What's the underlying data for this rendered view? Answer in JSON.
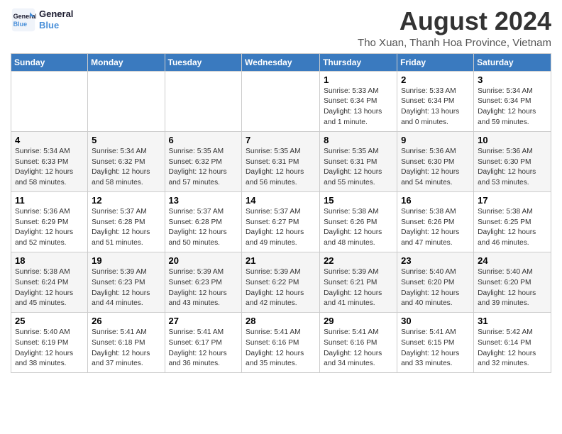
{
  "header": {
    "logo_line1": "General",
    "logo_line2": "Blue",
    "title": "August 2024",
    "subtitle": "Tho Xuan, Thanh Hoa Province, Vietnam"
  },
  "calendar": {
    "days_of_week": [
      "Sunday",
      "Monday",
      "Tuesday",
      "Wednesday",
      "Thursday",
      "Friday",
      "Saturday"
    ],
    "weeks": [
      [
        {
          "day": "",
          "info": ""
        },
        {
          "day": "",
          "info": ""
        },
        {
          "day": "",
          "info": ""
        },
        {
          "day": "",
          "info": ""
        },
        {
          "day": "1",
          "info": "Sunrise: 5:33 AM\nSunset: 6:34 PM\nDaylight: 13 hours\nand 1 minute."
        },
        {
          "day": "2",
          "info": "Sunrise: 5:33 AM\nSunset: 6:34 PM\nDaylight: 13 hours\nand 0 minutes."
        },
        {
          "day": "3",
          "info": "Sunrise: 5:34 AM\nSunset: 6:34 PM\nDaylight: 12 hours\nand 59 minutes."
        }
      ],
      [
        {
          "day": "4",
          "info": "Sunrise: 5:34 AM\nSunset: 6:33 PM\nDaylight: 12 hours\nand 58 minutes."
        },
        {
          "day": "5",
          "info": "Sunrise: 5:34 AM\nSunset: 6:32 PM\nDaylight: 12 hours\nand 58 minutes."
        },
        {
          "day": "6",
          "info": "Sunrise: 5:35 AM\nSunset: 6:32 PM\nDaylight: 12 hours\nand 57 minutes."
        },
        {
          "day": "7",
          "info": "Sunrise: 5:35 AM\nSunset: 6:31 PM\nDaylight: 12 hours\nand 56 minutes."
        },
        {
          "day": "8",
          "info": "Sunrise: 5:35 AM\nSunset: 6:31 PM\nDaylight: 12 hours\nand 55 minutes."
        },
        {
          "day": "9",
          "info": "Sunrise: 5:36 AM\nSunset: 6:30 PM\nDaylight: 12 hours\nand 54 minutes."
        },
        {
          "day": "10",
          "info": "Sunrise: 5:36 AM\nSunset: 6:30 PM\nDaylight: 12 hours\nand 53 minutes."
        }
      ],
      [
        {
          "day": "11",
          "info": "Sunrise: 5:36 AM\nSunset: 6:29 PM\nDaylight: 12 hours\nand 52 minutes."
        },
        {
          "day": "12",
          "info": "Sunrise: 5:37 AM\nSunset: 6:28 PM\nDaylight: 12 hours\nand 51 minutes."
        },
        {
          "day": "13",
          "info": "Sunrise: 5:37 AM\nSunset: 6:28 PM\nDaylight: 12 hours\nand 50 minutes."
        },
        {
          "day": "14",
          "info": "Sunrise: 5:37 AM\nSunset: 6:27 PM\nDaylight: 12 hours\nand 49 minutes."
        },
        {
          "day": "15",
          "info": "Sunrise: 5:38 AM\nSunset: 6:26 PM\nDaylight: 12 hours\nand 48 minutes."
        },
        {
          "day": "16",
          "info": "Sunrise: 5:38 AM\nSunset: 6:26 PM\nDaylight: 12 hours\nand 47 minutes."
        },
        {
          "day": "17",
          "info": "Sunrise: 5:38 AM\nSunset: 6:25 PM\nDaylight: 12 hours\nand 46 minutes."
        }
      ],
      [
        {
          "day": "18",
          "info": "Sunrise: 5:38 AM\nSunset: 6:24 PM\nDaylight: 12 hours\nand 45 minutes."
        },
        {
          "day": "19",
          "info": "Sunrise: 5:39 AM\nSunset: 6:23 PM\nDaylight: 12 hours\nand 44 minutes."
        },
        {
          "day": "20",
          "info": "Sunrise: 5:39 AM\nSunset: 6:23 PM\nDaylight: 12 hours\nand 43 minutes."
        },
        {
          "day": "21",
          "info": "Sunrise: 5:39 AM\nSunset: 6:22 PM\nDaylight: 12 hours\nand 42 minutes."
        },
        {
          "day": "22",
          "info": "Sunrise: 5:39 AM\nSunset: 6:21 PM\nDaylight: 12 hours\nand 41 minutes."
        },
        {
          "day": "23",
          "info": "Sunrise: 5:40 AM\nSunset: 6:20 PM\nDaylight: 12 hours\nand 40 minutes."
        },
        {
          "day": "24",
          "info": "Sunrise: 5:40 AM\nSunset: 6:20 PM\nDaylight: 12 hours\nand 39 minutes."
        }
      ],
      [
        {
          "day": "25",
          "info": "Sunrise: 5:40 AM\nSunset: 6:19 PM\nDaylight: 12 hours\nand 38 minutes."
        },
        {
          "day": "26",
          "info": "Sunrise: 5:41 AM\nSunset: 6:18 PM\nDaylight: 12 hours\nand 37 minutes."
        },
        {
          "day": "27",
          "info": "Sunrise: 5:41 AM\nSunset: 6:17 PM\nDaylight: 12 hours\nand 36 minutes."
        },
        {
          "day": "28",
          "info": "Sunrise: 5:41 AM\nSunset: 6:16 PM\nDaylight: 12 hours\nand 35 minutes."
        },
        {
          "day": "29",
          "info": "Sunrise: 5:41 AM\nSunset: 6:16 PM\nDaylight: 12 hours\nand 34 minutes."
        },
        {
          "day": "30",
          "info": "Sunrise: 5:41 AM\nSunset: 6:15 PM\nDaylight: 12 hours\nand 33 minutes."
        },
        {
          "day": "31",
          "info": "Sunrise: 5:42 AM\nSunset: 6:14 PM\nDaylight: 12 hours\nand 32 minutes."
        }
      ]
    ]
  }
}
